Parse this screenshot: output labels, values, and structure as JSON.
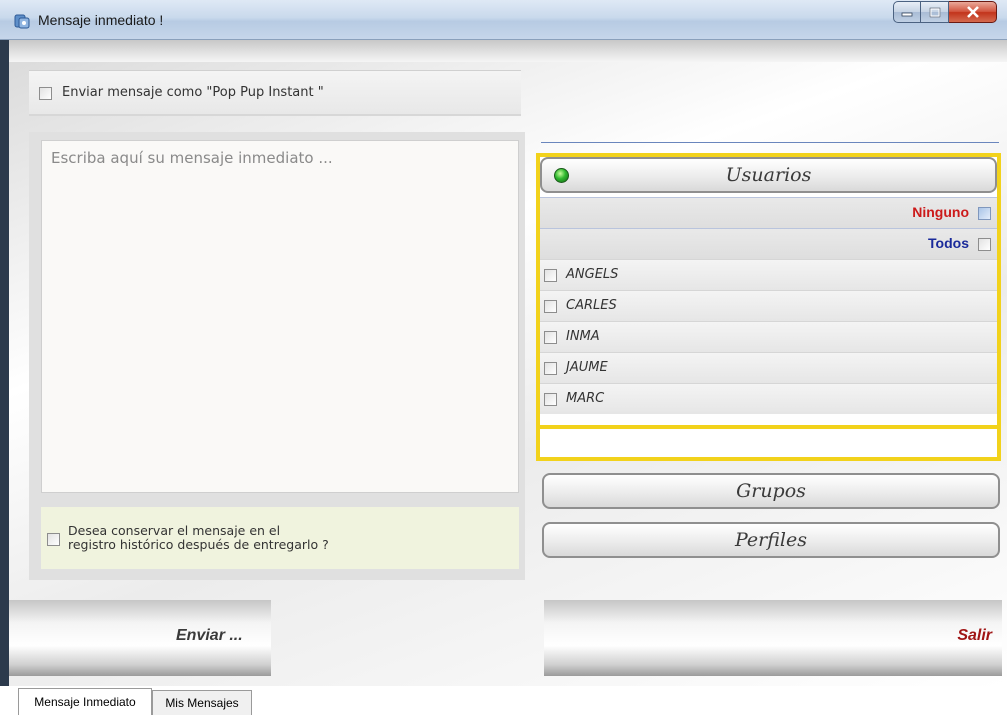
{
  "window": {
    "title": "Mensaje inmediato !",
    "controls": {
      "minimize": "–",
      "maximize": "□",
      "close": "x"
    }
  },
  "popup_option": {
    "label": "Enviar mensaje como \"Pop Pup Instant \"",
    "checked": false
  },
  "message": {
    "placeholder": "Escriba aquí su mensaje inmediato ...",
    "value": ""
  },
  "keep_history": {
    "line1": "Desea conservar el mensaje en el",
    "line2": "registro histórico después de entregarlo ?",
    "checked": false
  },
  "users_panel": {
    "title": "Usuarios",
    "status_color": "#2fb82f",
    "none_label": "Ninguno",
    "none_color": "#cc1a1a",
    "all_label": "Todos",
    "all_color": "#1a2a9a",
    "users": [
      "ANGELS",
      "CARLES",
      "INMA",
      "JAUME",
      "MARC"
    ]
  },
  "groups_label": "Grupos",
  "profiles_label": "Perfiles",
  "send_label": "Enviar ...",
  "exit_label": "Salir",
  "tabs": [
    {
      "label": "Mensaje Inmediato",
      "active": true
    },
    {
      "label": "Mis Mensajes",
      "active": false
    }
  ],
  "colors": {
    "highlight_border": "#f2d21b",
    "exit_text": "#a01515"
  }
}
